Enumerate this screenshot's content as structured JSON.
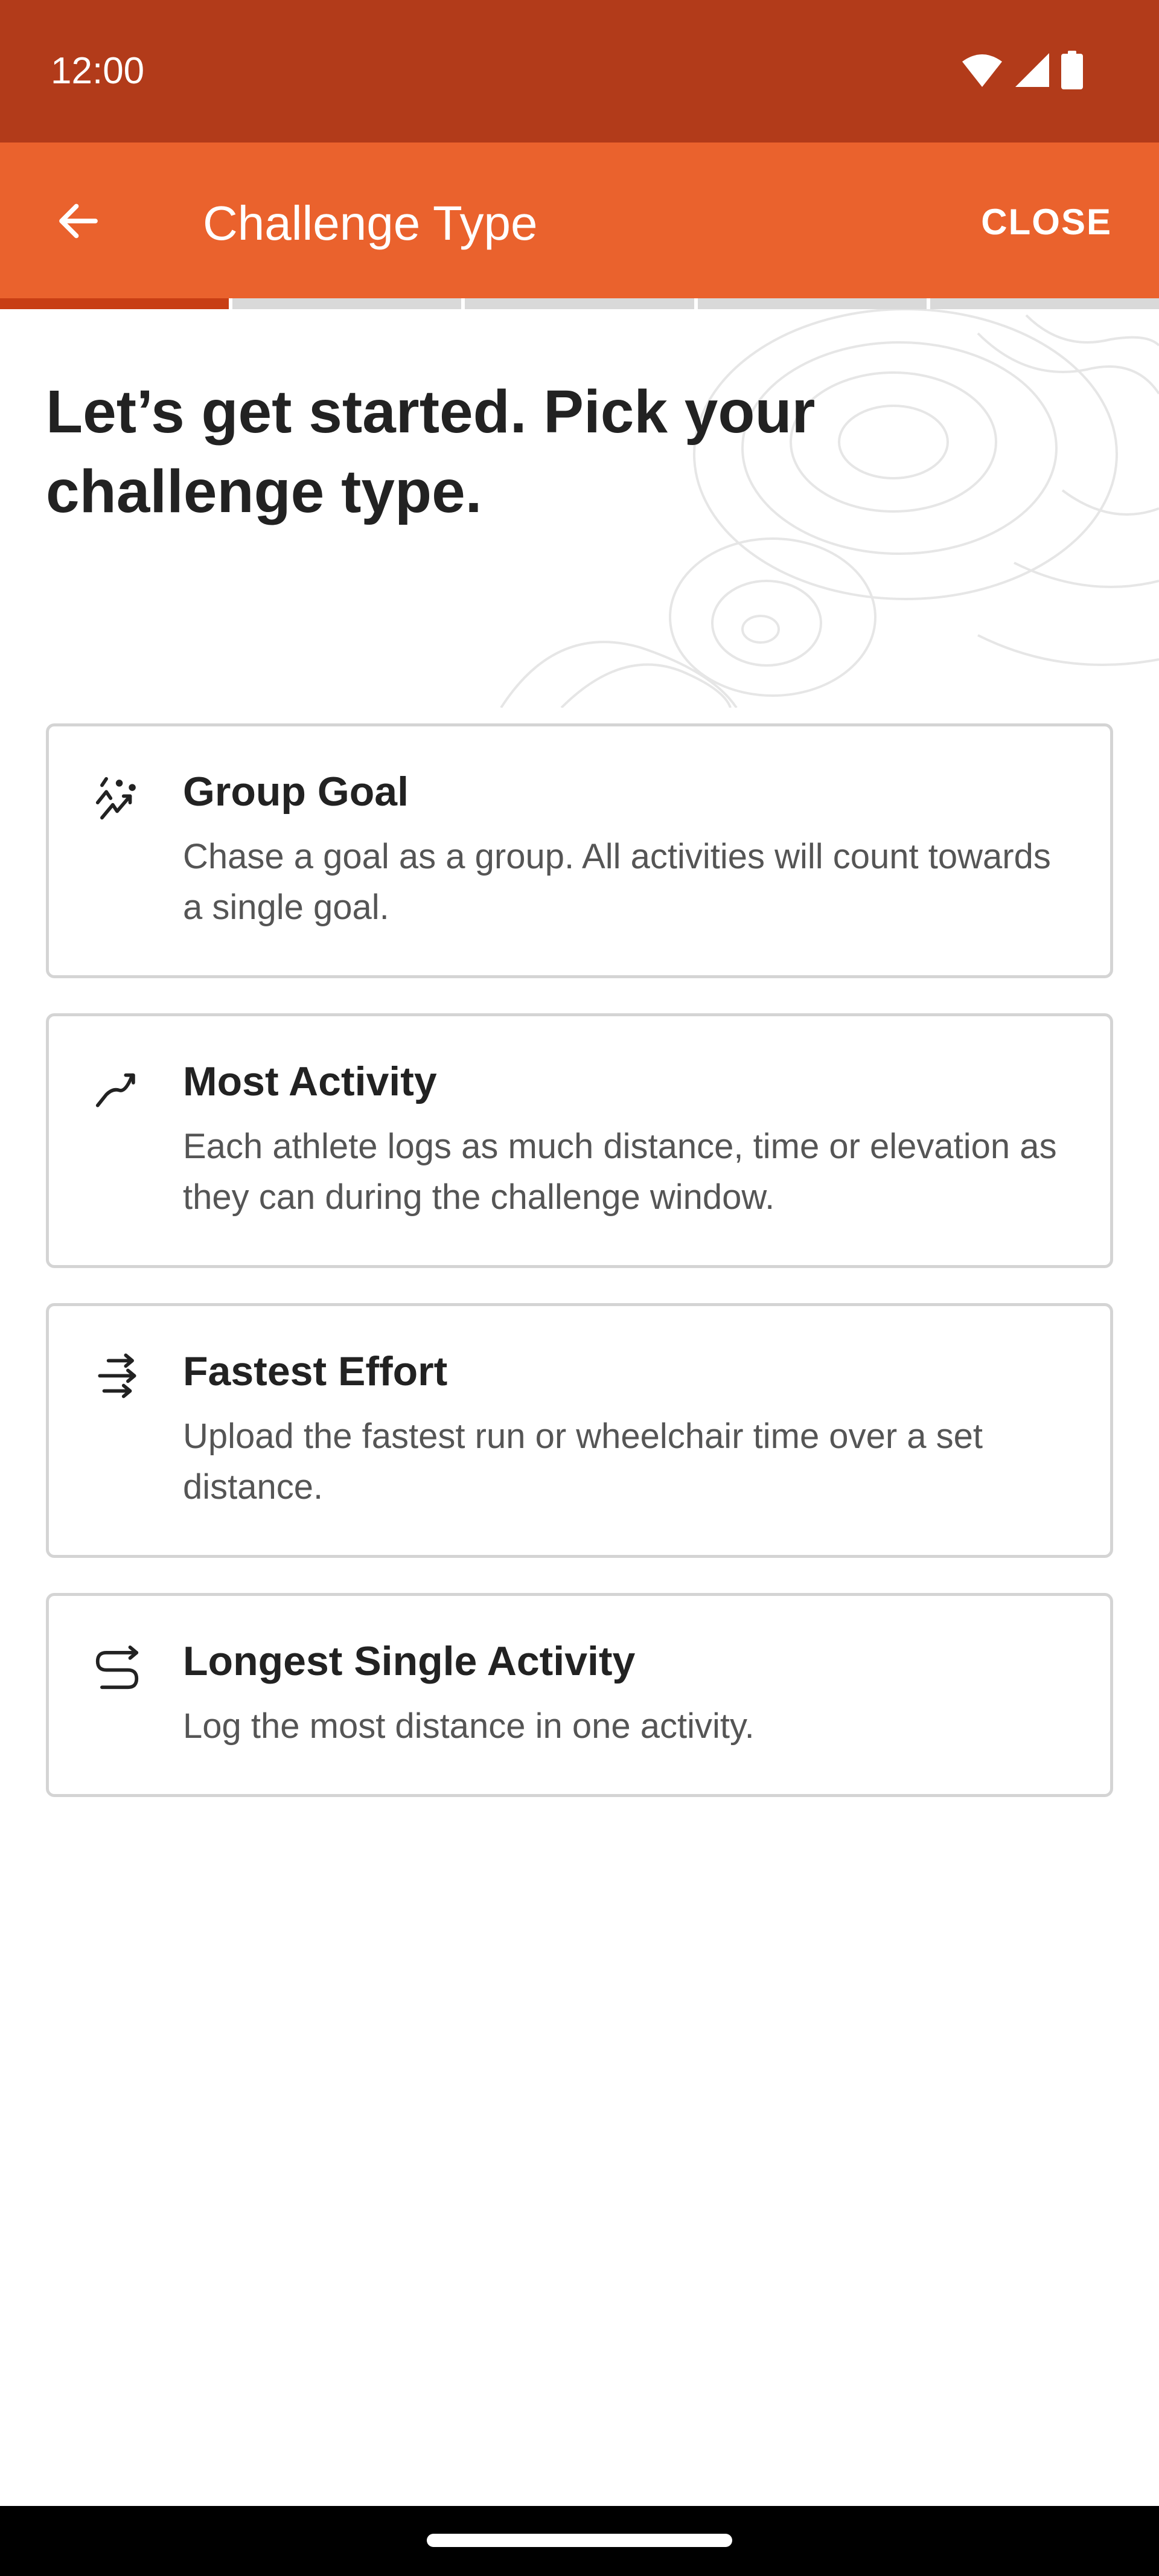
{
  "status_bar": {
    "time": "12:00"
  },
  "app_bar": {
    "title": "Challenge Type",
    "close_label": "CLOSE"
  },
  "progress": {
    "total_steps": 5,
    "current_step": 1
  },
  "heading": "Let’s get started. Pick your challenge type.",
  "options": [
    {
      "title": "Group Goal",
      "description": "Chase a goal as a group. All activities will count towards a single goal.",
      "icon": "group-goal-icon"
    },
    {
      "title": "Most Activity",
      "description": "Each athlete logs as much distance, time or elevation as they can during the challenge window.",
      "icon": "trend-up-icon"
    },
    {
      "title": "Fastest Effort",
      "description": "Upload the fastest run or wheelchair time over a set distance.",
      "icon": "speed-arrows-icon"
    },
    {
      "title": "Longest Single Activity",
      "description": "Log the most distance in one activity.",
      "icon": "route-icon"
    }
  ],
  "colors": {
    "status_bar": "#B23B1A",
    "app_bar": "#EA622D",
    "progress_active": "#C83E14"
  }
}
